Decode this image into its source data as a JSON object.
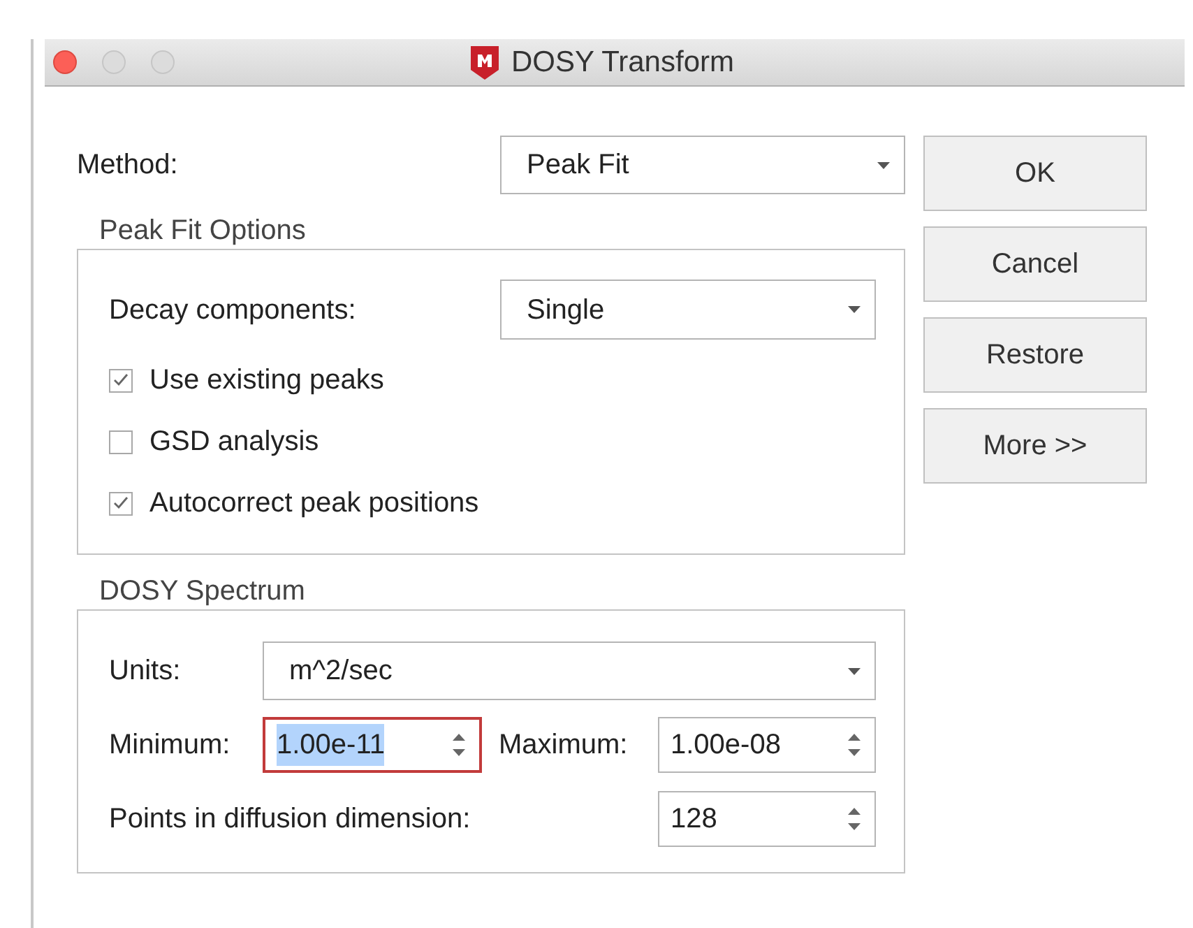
{
  "window": {
    "title": "DOSY Transform"
  },
  "method": {
    "label": "Method:",
    "value": "Peak Fit"
  },
  "peak_fit_options": {
    "title": "Peak Fit Options",
    "decay_components": {
      "label": "Decay components:",
      "value": "Single"
    },
    "checkboxes": [
      {
        "label": "Use existing peaks",
        "checked": true
      },
      {
        "label": "GSD analysis",
        "checked": false
      },
      {
        "label": "Autocorrect peak positions",
        "checked": true
      }
    ]
  },
  "dosy_spectrum": {
    "title": "DOSY Spectrum",
    "units": {
      "label": "Units:",
      "value": "m^2/sec"
    },
    "minimum": {
      "label": "Minimum:",
      "value": "1.00e-11",
      "focused": true
    },
    "maximum": {
      "label": "Maximum:",
      "value": "1.00e-08",
      "focused": false
    },
    "points": {
      "label": "Points in diffusion dimension:",
      "value": "128",
      "focused": false
    }
  },
  "buttons": [
    "OK",
    "Cancel",
    "Restore",
    "More >>"
  ]
}
